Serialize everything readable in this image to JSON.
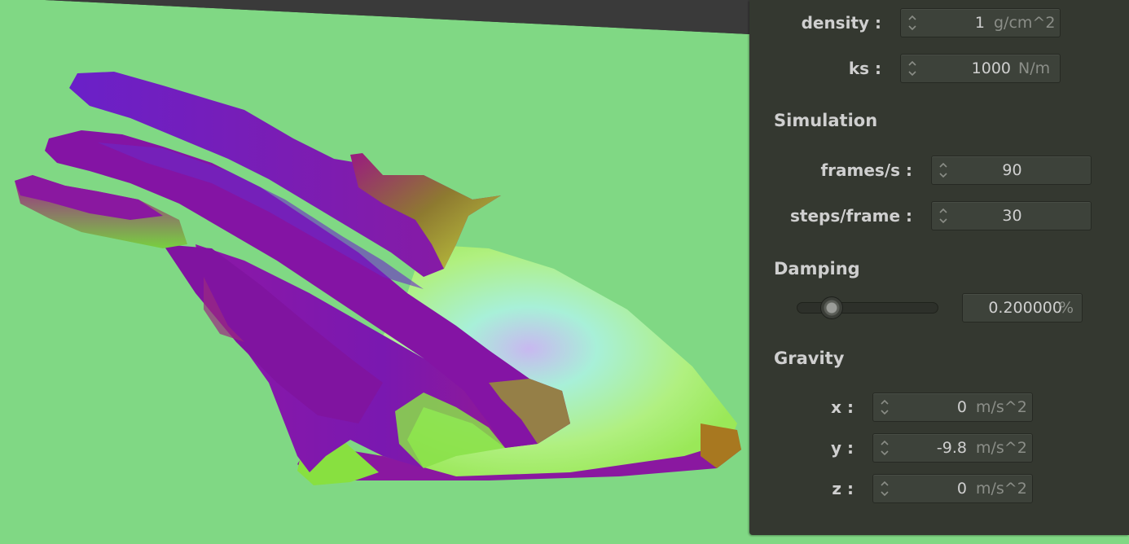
{
  "panel": {
    "spring": {
      "density": {
        "label": "density :",
        "value": "1",
        "unit": "g/cm^2"
      },
      "ks": {
        "label": "ks :",
        "value": "1000",
        "unit": "N/m"
      }
    },
    "simulation": {
      "title": "Simulation",
      "fps": {
        "label": "frames/s :",
        "value": "90"
      },
      "steps": {
        "label": "steps/frame :",
        "value": "30"
      }
    },
    "damping": {
      "title": "Damping",
      "value": "0.200000",
      "unit": "%",
      "slider_fraction": 0.2
    },
    "gravity": {
      "title": "Gravity",
      "x": {
        "label": "x :",
        "value": "0",
        "unit": "m/s^2"
      },
      "y": {
        "label": "y :",
        "value": "-9.8",
        "unit": "m/s^2"
      },
      "z": {
        "label": "z :",
        "value": "0",
        "unit": "m/s^2"
      }
    }
  },
  "colors": {
    "viewport_bg": "#80d884",
    "panel_bg": "#343830",
    "cloth_purple": "#8a1aa8",
    "cloth_green": "#a8f060"
  },
  "icons": {
    "spinner": "spinner-arrows-icon"
  }
}
